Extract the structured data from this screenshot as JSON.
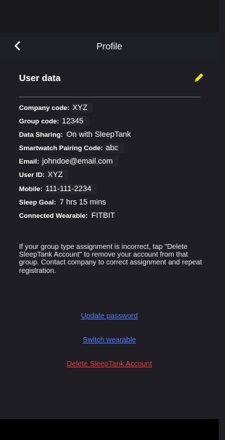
{
  "header": {
    "title": "Profile"
  },
  "section": {
    "title": "User data"
  },
  "fields": [
    {
      "label": "Company code:",
      "value": "XYZ"
    },
    {
      "label": "Group code:",
      "value": "12345"
    },
    {
      "label": "Data Sharing:",
      "value": "On with SleepTank"
    },
    {
      "label": "Smartwatch Pairing Code:",
      "value": "abc"
    },
    {
      "label": "Email:",
      "value": "johndoe@email.com"
    },
    {
      "label": "User ID:",
      "value": "XYZ"
    },
    {
      "label": "Mobile:",
      "value": "111-111-2234"
    },
    {
      "label": "Sleep Goal:",
      "value": "7 hrs 15 mins"
    },
    {
      "label": "Connected Wearable:",
      "value": "FITBIT"
    }
  ],
  "note": "If your group type assignment is incorrect, tap \"Delete SleepTank Account\" to remove your account from that group. Contact company to correct assignment and repeat registration.",
  "links": {
    "update_password": "Update password",
    "switch_wearable": "Switch wearable",
    "delete_account": "Delete SleepTank Account"
  },
  "colors": {
    "background": "#1e1e24",
    "accent_link": "#4f7cff",
    "danger": "#e8383a",
    "edit_icon": "#f2e500"
  },
  "icons": {
    "back": "chevron-left-icon",
    "edit": "pencil-icon"
  }
}
